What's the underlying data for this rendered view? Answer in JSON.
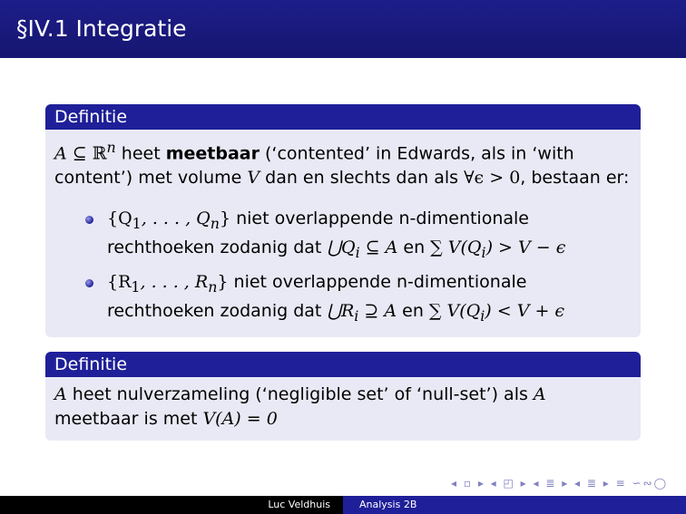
{
  "slide": {
    "title": "§IV.1 Integratie"
  },
  "def1": {
    "title": "Definitie",
    "intro": {
      "a": "A",
      "subseteq": " ⊆ ",
      "rn": "ℝ",
      "n": "n",
      "heet": " heet ",
      "meetbaar": "meetbaar",
      "text1": " (‘contented’ in Edwards, als in ‘with content’) met volume ",
      "v": "V",
      "text2": " dan en slechts dan als ",
      "forall": "∀ϵ > 0",
      "text3": ", bestaan er:"
    },
    "item1": {
      "set": "{Q",
      "s1": "1",
      "mid": ", . . . , Q",
      "sn": "n",
      "close": "}",
      "text": " niet overlappende n-dimentionale rechthoeken zodanig dat ",
      "union": "⋃Q",
      "ui": "i",
      "rel": " ⊆ A",
      "en": " en ",
      "sum": "∑ V(Q",
      "si": "i",
      "cond": ") > V − ϵ"
    },
    "item2": {
      "set": "{R",
      "s1": "1",
      "mid": ", . . . , R",
      "sn": "n",
      "close": "}",
      "text": " niet overlappende n-dimentionale rechthoeken zodanig dat ",
      "union": "⋃R",
      "ui": "i",
      "rel": " ⊇ A",
      "en": " en ",
      "sum": "∑ V(Q",
      "si": "i",
      "cond": ") < V + ϵ"
    }
  },
  "def2": {
    "title": "Definitie",
    "a": "A",
    "text1": " heet nulverzameling (‘negligible set’ of ‘null-set’) als ",
    "a2": "A",
    "text2": " meetbaar is met ",
    "formula": "V(A) = 0"
  },
  "nav": {
    "symbols": "◂ ▫ ▸ ◂ ◰ ▸ ◂ ≣ ▸ ◂ ≣ ▸ ≡ ∽∾◯"
  },
  "footer": {
    "author": "Luc Veldhuis",
    "course": "Analysis 2B"
  }
}
